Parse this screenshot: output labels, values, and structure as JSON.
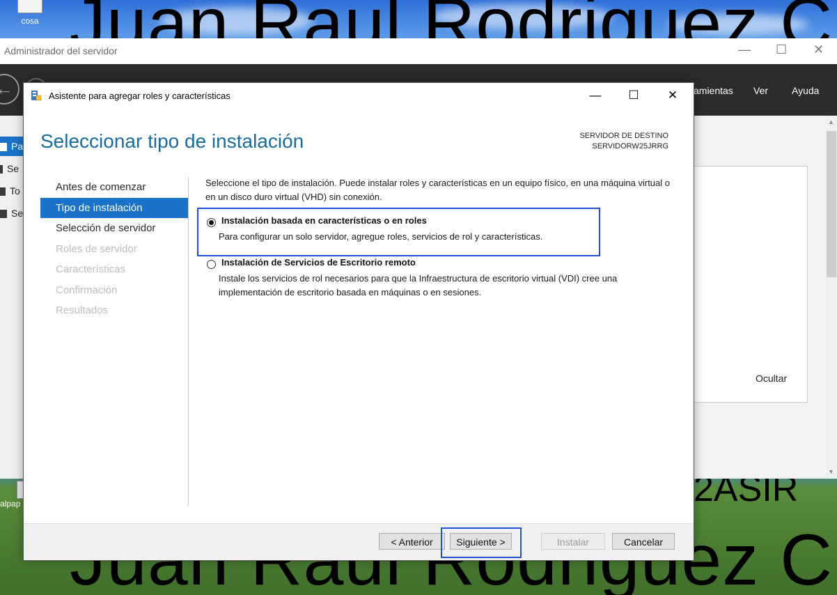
{
  "desktop": {
    "wallpaper_text_top": "Juan Raul Rodriguez C",
    "wallpaper_text_bottom": "Juan Raul Rodriguez C",
    "wallpaper_text_side": "2ASIR",
    "icons": [
      {
        "label": "cosa"
      },
      {
        "label": "alpap"
      }
    ]
  },
  "server_manager": {
    "title": "Administrador del servidor",
    "menu": [
      "amientas",
      "Ver",
      "Ayuda"
    ],
    "sidebar_items": [
      "Pa",
      "Se",
      "To",
      "Se"
    ],
    "hide_label": "Ocultar"
  },
  "wizard": {
    "title": "Asistente para agregar roles y características",
    "header": "Seleccionar tipo de instalación",
    "destination": {
      "label": "SERVIDOR DE DESTINO",
      "server": "SERVIDORW25JRRG"
    },
    "nav": [
      {
        "label": "Antes de comenzar",
        "state": "normal"
      },
      {
        "label": "Tipo de instalación",
        "state": "selected"
      },
      {
        "label": "Selección de servidor",
        "state": "normal"
      },
      {
        "label": "Roles de servidor",
        "state": "disabled"
      },
      {
        "label": "Características",
        "state": "disabled"
      },
      {
        "label": "Confirmación",
        "state": "disabled"
      },
      {
        "label": "Resultados",
        "state": "disabled"
      }
    ],
    "intro": "Seleccione el tipo de instalación. Puede instalar roles y características en un equipo físico, en una máquina virtual o en un disco duro virtual (VHD) sin conexión.",
    "options": [
      {
        "title": "Instalación basada en características o en roles",
        "description": "Para configurar un solo servidor, agregue roles, servicios de rol y características.",
        "selected": true
      },
      {
        "title": "Instalación de Servicios de Escritorio remoto",
        "description": "Instale los servicios de rol necesarios para que la Infraestructura de escritorio virtual (VDI) cree una implementación de escritorio basada en máquinas o en sesiones.",
        "selected": false
      }
    ],
    "buttons": {
      "previous": "< Anterior",
      "next": "Siguiente >",
      "install": "Instalar",
      "cancel": "Cancelar"
    }
  }
}
